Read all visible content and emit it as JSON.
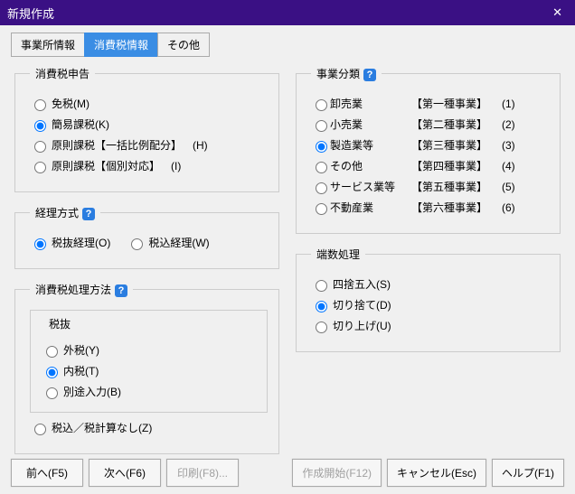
{
  "title": "新規作成",
  "tabs": [
    "事業所情報",
    "消費税情報",
    "その他"
  ],
  "group_shinkoku": "消費税申告",
  "shinkoku": [
    {
      "label": "免税(M)",
      "suffix": ""
    },
    {
      "label": "簡易課税(K)",
      "suffix": ""
    },
    {
      "label": "原則課税【一括比例配分】",
      "suffix": "(H)"
    },
    {
      "label": "原則課税【個別対応】",
      "suffix": "(I)"
    }
  ],
  "group_keiri": "経理方式",
  "keiri": [
    "税抜経理(O)",
    "税込経理(W)"
  ],
  "group_shori": "消費税処理方法",
  "zeinuki_title": "税抜",
  "shori_zeinuki": [
    "外税(Y)",
    "内税(T)",
    "別途入力(B)"
  ],
  "shori_last": "税込／税計算なし(Z)",
  "group_jigyo": "事業分類",
  "jigyo": [
    {
      "c1": "卸売業",
      "c2": "【第一種事業】",
      "c3": "(1)"
    },
    {
      "c1": "小売業",
      "c2": "【第二種事業】",
      "c3": "(2)"
    },
    {
      "c1": "製造業等",
      "c2": "【第三種事業】",
      "c3": "(3)"
    },
    {
      "c1": "その他",
      "c2": "【第四種事業】",
      "c3": "(4)"
    },
    {
      "c1": "サービス業等",
      "c2": "【第五種事業】",
      "c3": "(5)"
    },
    {
      "c1": "不動産業",
      "c2": "【第六種事業】",
      "c3": "(6)"
    }
  ],
  "group_hasuu": "端数処理",
  "hasuu": [
    "四捨五入(S)",
    "切り捨て(D)",
    "切り上げ(U)"
  ],
  "buttons": {
    "prev": "前へ(F5)",
    "next": "次へ(F6)",
    "print": "印刷(F8)...",
    "start": "作成開始(F12)",
    "cancel": "キャンセル(Esc)",
    "help": "ヘルプ(F1)"
  }
}
